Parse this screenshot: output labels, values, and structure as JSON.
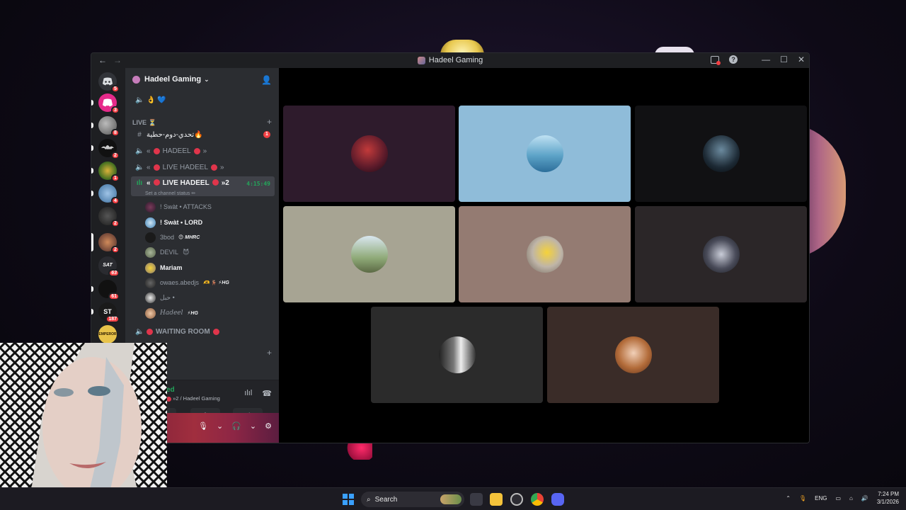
{
  "window": {
    "title": "Hadeel Gaming",
    "back_label": "←",
    "forward_label": "→",
    "minimize_label": "—",
    "maximize_label": "☐",
    "close_label": "✕"
  },
  "server_rail": {
    "badges": [
      "5",
      "3",
      "8",
      "2",
      "1",
      "4",
      "2",
      "2",
      "63",
      "61",
      "187"
    ],
    "server_labels": {
      "st": "ST",
      "sat": "SAT",
      "emperor": "EMPEROR"
    }
  },
  "sidebar": {
    "server_name": "Hadeel Gaming",
    "channels": {
      "top_voice": "👌 💙",
      "category_live": "LIVE ⏳",
      "text_channel": "تحدي-دوم-حطية🔥",
      "text_channel_unread": "1",
      "voice_hadeel": "HADEEL",
      "voice_live_hadeel": "LIVE HADEEL",
      "active_voice": "LIVE HADEEL",
      "active_suffix": "»2",
      "active_timer": "4:15:49",
      "status_hint": "Set a channel status ✏",
      "waiting_room": "WAITING ROOM"
    },
    "voice_users": [
      {
        "name": "! Swàt • ATTACKS",
        "tag": ""
      },
      {
        "name": "! Swàt • LORD",
        "tag": ""
      },
      {
        "name": "3bod",
        "tag": "😊 MHRC"
      },
      {
        "name": "DEVIL",
        "tag": "😈"
      },
      {
        "name": "Mariam",
        "tag": ""
      },
      {
        "name": "owaes.abedjs",
        "tag": "🫶 🦌 ⚡HG"
      },
      {
        "name": "حبل •",
        "tag": ""
      },
      {
        "name": "Hadeel",
        "tag": "⚡HG"
      }
    ],
    "voice_panel": {
      "status": "ed",
      "location": "»2 / Hadeel Gaming"
    }
  },
  "colors": {
    "accent": "#23a55a",
    "danger": "#f23f43",
    "live_dot": "#e0354b"
  },
  "taskbar": {
    "search_placeholder": "Search",
    "language": "ENG",
    "time": "7:24 PM",
    "date": "3/1/2026"
  }
}
